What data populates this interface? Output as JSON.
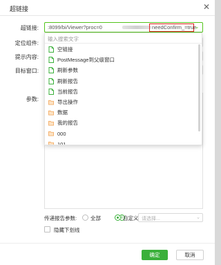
{
  "dialog": {
    "title": "超链接",
    "close_icon": "close-icon"
  },
  "form": {
    "labels": {
      "hyperlink": "超链接:",
      "locate_component": "定位组件:",
      "hint_content": "提示内容:",
      "target_window": "目标窗口:",
      "params": "参数:"
    },
    "url": {
      "value": ":8099/bi/Viewer?proc=0",
      "highlighted": "needConfirm_=true"
    }
  },
  "dropdown": {
    "search_placeholder": "输入搜索文字",
    "items": [
      {
        "label": "空链接",
        "icon": "file-icon"
      },
      {
        "label": "PostMessage到父级窗口",
        "icon": "file-icon"
      },
      {
        "label": "刷新参数",
        "icon": "file-icon"
      },
      {
        "label": "刷新报告",
        "icon": "file-icon"
      },
      {
        "label": "当前报告",
        "icon": "file-icon"
      },
      {
        "label": "导出操作",
        "icon": "folder-icon"
      },
      {
        "label": "数据",
        "icon": "folder-icon"
      },
      {
        "label": "我的报告",
        "icon": "folder-icon"
      },
      {
        "label": "000",
        "icon": "folder-icon"
      },
      {
        "label": "101",
        "icon": "folder-icon"
      }
    ]
  },
  "pending_params": {
    "label": "传递报告参数:",
    "options": [
      "全部",
      "自定义"
    ],
    "selected": "自定义",
    "info_icon": "info-icon",
    "select_placeholder": "请选择..."
  },
  "checkbox": {
    "label": "隐藏下划线",
    "checked": false
  },
  "buttons": {
    "ok": "确定",
    "cancel": "取消"
  },
  "colors": {
    "accent": "#3ab03a",
    "highlight_border": "#e02020",
    "file_icon": "#3ab03a",
    "folder_icon": "#f2a65a"
  }
}
